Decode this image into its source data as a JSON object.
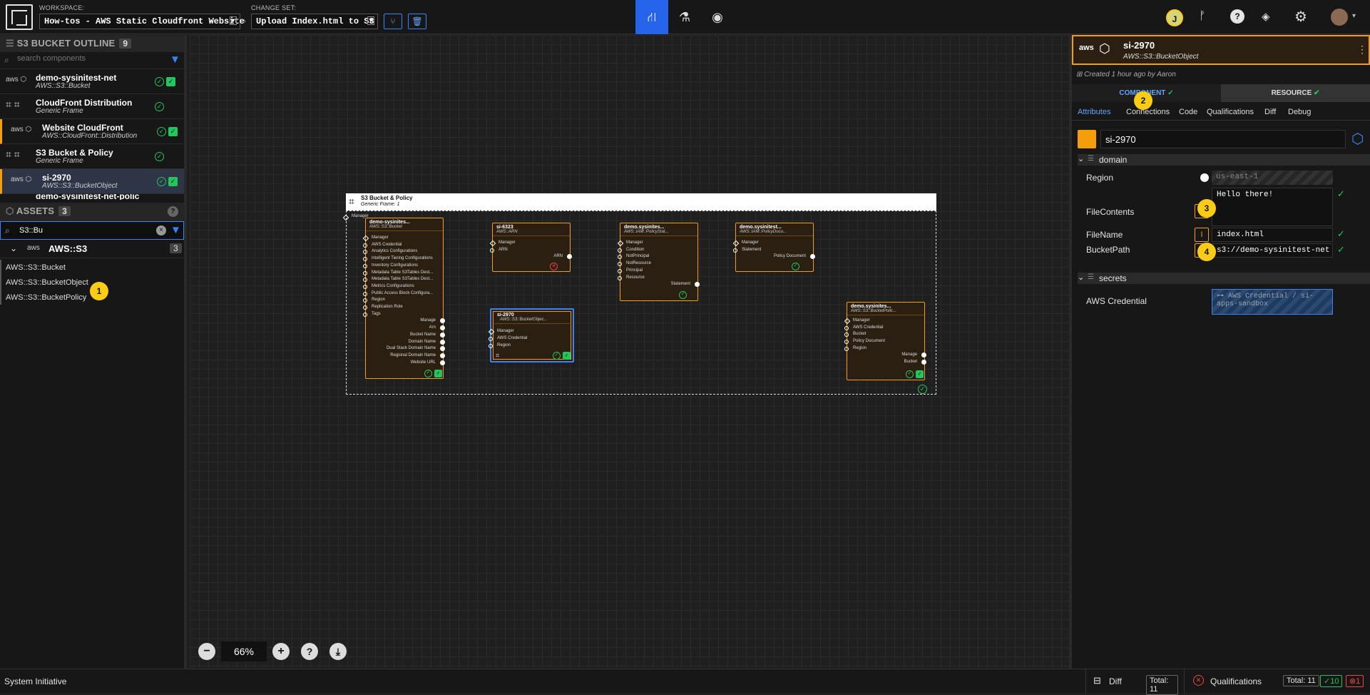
{
  "topbar": {
    "workspace_label": "WORKSPACE:",
    "workspace_value": "How-tos - AWS Static Cloudfront Website",
    "changeset_label": "CHANGE SET:",
    "changeset_value": "Upload Index.html to S3",
    "user_initial": "J"
  },
  "outline": {
    "title": "S3 BUCKET OUTLINE",
    "count": "9",
    "search_placeholder": "search components",
    "items": [
      {
        "title": "demo-sysinitest-net",
        "subtitle": "AWS::S3::Bucket",
        "icon": "aws"
      },
      {
        "title": "CloudFront Distribution",
        "subtitle": "Generic Frame",
        "icon": "frame"
      },
      {
        "title": "Website CloudFront",
        "subtitle": "AWS::CloudFront::Distribution",
        "icon": "aws"
      },
      {
        "title": "S3 Bucket & Policy",
        "subtitle": "Generic Frame",
        "icon": "frame"
      },
      {
        "title": "si-2970",
        "subtitle": "AWS::S3::BucketObject",
        "icon": "aws"
      },
      {
        "title": "demo-sysinitest-net-polic",
        "subtitle": "",
        "icon": "aws"
      }
    ]
  },
  "assets": {
    "title": "ASSETS",
    "count": "3",
    "search_value": "S3::Bu",
    "group": {
      "name": "AWS::S3",
      "count": "3"
    },
    "items": [
      "AWS::S3::Bucket",
      "AWS::S3::BucketObject",
      "AWS::S3::BucketPolicy"
    ]
  },
  "canvas": {
    "zoom": "66%",
    "frame": {
      "title": "S3 Bucket & Policy",
      "subtitle": "Generic Frame: 1",
      "manager_label": "Manager"
    },
    "nodes": {
      "bucket": {
        "title": "demo-sysinites...",
        "subtitle": "AWS::S3::Bucket",
        "inputs": [
          "Manager",
          "AWS Credential",
          "Analytics Configurations",
          "Intelligent Tiering Configurations",
          "Inventory Configurations",
          "Metadata Table S3Tables Dest...",
          "Metadata Table S3Tables Dest...",
          "Metrics Configurations",
          "Public Access Block Configura...",
          "Region",
          "Replication Role",
          "Tags"
        ],
        "outputs": [
          "Manage",
          "Arn",
          "Bucket Name",
          "Domain Name",
          "Dual Stack Domain Name",
          "Regional Domain Name",
          "Website URL"
        ]
      },
      "arn": {
        "title": "si-6323",
        "subtitle": "AWS::ARN",
        "inputs": [
          "Manager",
          "ARN"
        ],
        "outputs": [
          "ARN"
        ]
      },
      "policystmt": {
        "title": "demo.sysinites...",
        "subtitle": "AWS::IAM::PolicyStat...",
        "inputs": [
          "Manager",
          "Condition",
          "NotPrincipal",
          "NotResource",
          "Principal",
          "Resource"
        ],
        "outputs": [
          "Statement"
        ]
      },
      "policydoc": {
        "title": "demo.sysinitest...",
        "subtitle": "AWS::IAM::PolicyDocu...",
        "inputs": [
          "Manager",
          "Statement"
        ],
        "outputs": [
          "Policy Document"
        ]
      },
      "object": {
        "title": "si-2970",
        "subtitle": "AWS::S3::BucketObjec...",
        "inputs": [
          "Manager",
          "AWS Credential",
          "Region"
        ]
      },
      "bucketpolicy": {
        "title": "demo.sysinites...",
        "subtitle": "AWS::S3::BucketPolic...",
        "inputs": [
          "Manager",
          "AWS Credential",
          "Bucket",
          "Policy Document",
          "Region"
        ],
        "outputs": [
          "Manage",
          "Bucket"
        ]
      }
    }
  },
  "details": {
    "name": "si-2970",
    "type": "AWS::S3::BucketObject",
    "created": "Created 1 hour ago by Aaron",
    "tab_component": "COMPONENT",
    "tab_resource": "RESOURCE",
    "subtabs": [
      "Attributes",
      "Connections",
      "Code",
      "Qualifications",
      "Diff",
      "Debug"
    ],
    "name_field": "si-2970",
    "color": "#f59e0b",
    "domain_label": "domain",
    "secrets_label": "secrets",
    "region_label": "Region",
    "region_placeholder": "us-east-1",
    "filecontents_label": "FileContents",
    "filecontents_value": "Hello there!",
    "filename_label": "FileName",
    "filename_value": "index.html",
    "bucketpath_label": "BucketPath",
    "bucketpath_value": "s3://demo-sysinitest-net",
    "credential_label": "AWS Credential",
    "credential_value": "⊶ AWS Credential / si-apps-sandbox"
  },
  "badges": [
    "1",
    "2",
    "3",
    "4"
  ],
  "status": {
    "app": "System Initiative",
    "diff_label": "Diff",
    "diff_total": "Total: 11",
    "qual_label": "Qualifications",
    "qual_total": "Total: 11",
    "qual_ok": "10",
    "qual_fail": "1"
  }
}
